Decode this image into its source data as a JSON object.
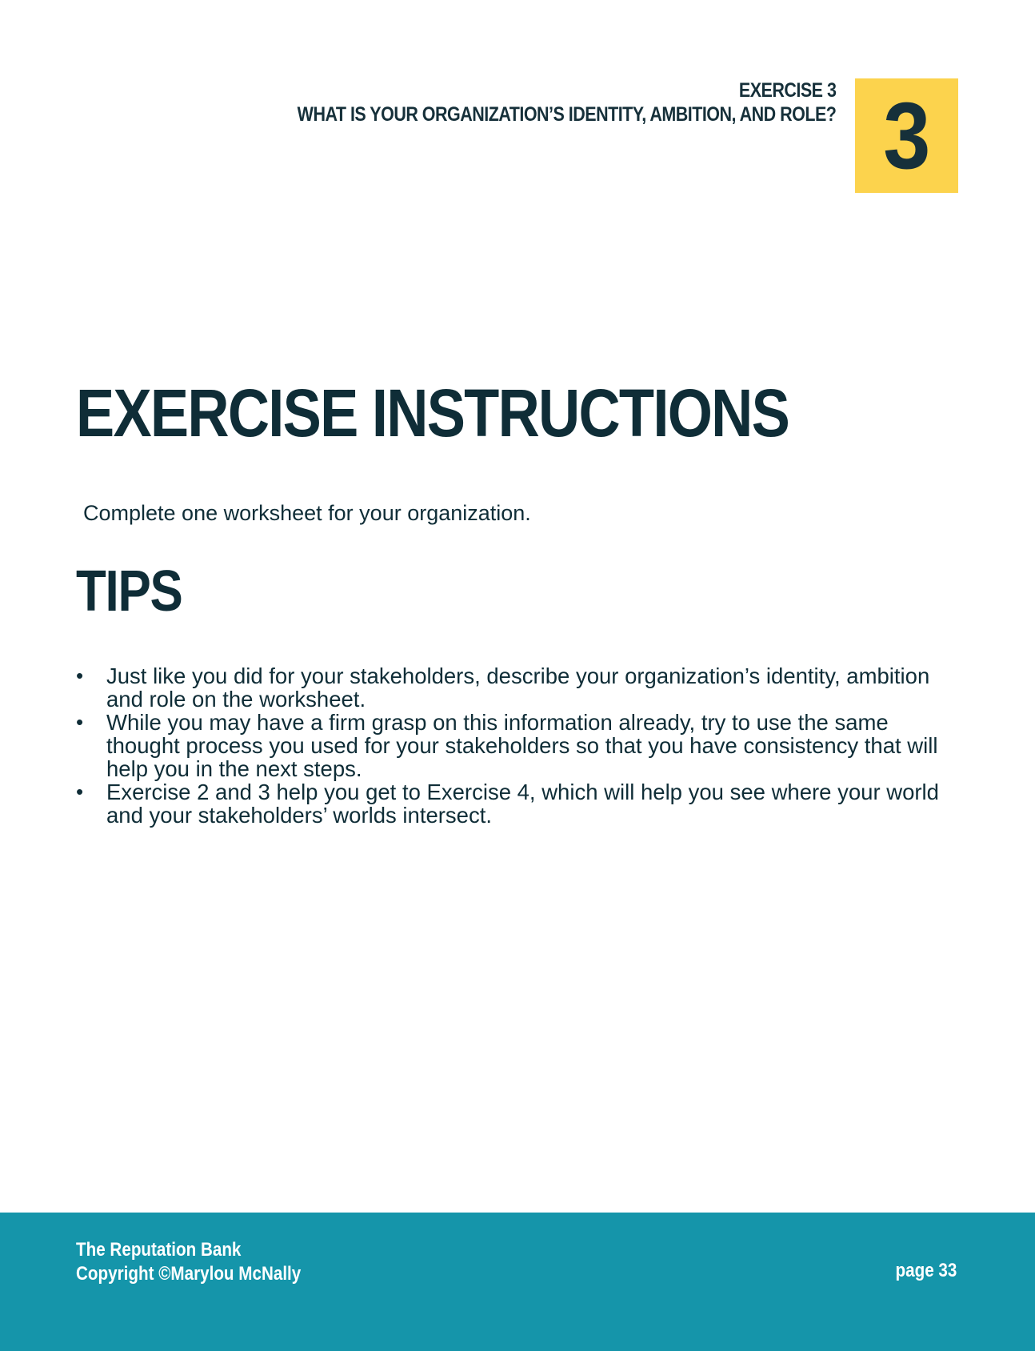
{
  "header": {
    "exercise_label": "EXERCISE 3",
    "question": "WHAT IS YOUR ORGANIZATION’S IDENTITY, AMBITION, AND ROLE?",
    "badge_number": "3"
  },
  "main": {
    "title": "EXERCISE INSTRUCTIONS",
    "instruction": "Complete one worksheet for your organization.",
    "tips_title": "TIPS",
    "tips": [
      "Just like you did for your stakeholders, describe your organization’s identity, ambition and role on the worksheet.",
      "While you may have a firm grasp on this information already, try to use the same thought process you used for your stakeholders so that you have consistency that will help you in the next steps.",
      "Exercise 2 and 3 help you get to Exercise 4, which will help you see where your world and your stakeholders’ worlds intersect."
    ],
    "bullet_glyph": "•"
  },
  "footer": {
    "line1": "The Reputation Bank",
    "line2": "Copyright ©Marylou McNally",
    "page": "page 33"
  },
  "colors": {
    "badge": "#fcd34d",
    "footer": "#1595aa",
    "text": "#0f2d37"
  }
}
